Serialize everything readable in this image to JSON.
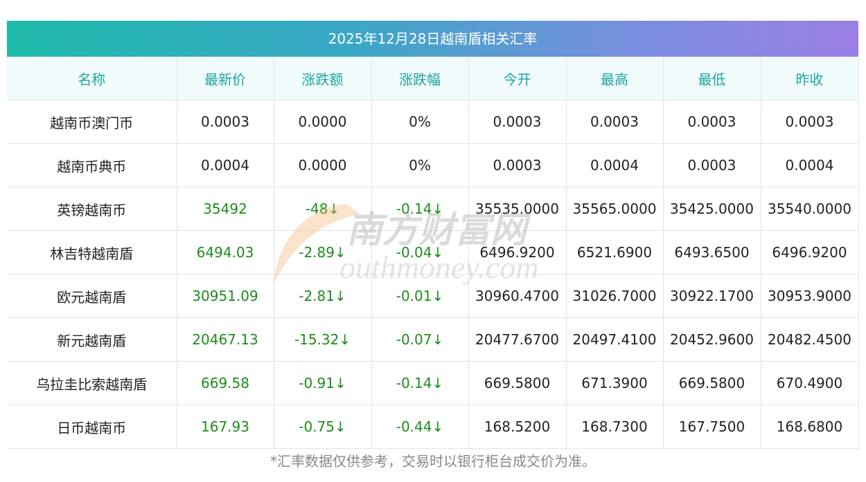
{
  "title": "2025年12月28日越南盾相关汇率",
  "headers": [
    "名称",
    "最新价",
    "涨跌额",
    "涨跌幅",
    "今开",
    "最高",
    "最低",
    "昨收"
  ],
  "rows": [
    [
      "越南币澳门币",
      "0.0003",
      "0.0000",
      "0%",
      "0.0003",
      "0.0003",
      "0.0003",
      "0.0003"
    ],
    [
      "越南币典币",
      "0.0004",
      "0.0000",
      "0%",
      "0.0003",
      "0.0004",
      "0.0003",
      "0.0004"
    ],
    [
      "英镑越南币",
      "35492",
      "-48↓",
      "-0.14↓",
      "35535.0000",
      "35565.0000",
      "35425.0000",
      "35540.0000"
    ],
    [
      "林吉特越南盾",
      "6494.03",
      "-2.89↓",
      "-0.04↓",
      "6496.9200",
      "6521.6900",
      "6493.6500",
      "6496.9200"
    ],
    [
      "欧元越南盾",
      "30951.09",
      "-2.81↓",
      "-0.01↓",
      "30960.4700",
      "31026.7000",
      "30922.1700",
      "30953.9000"
    ],
    [
      "新元越南盾",
      "20467.13",
      "-15.32↓",
      "-0.07↓",
      "20477.6700",
      "20497.4100",
      "20452.9600",
      "20482.4500"
    ],
    [
      "乌拉圭比索越南盾",
      "669.58",
      "-0.91↓",
      "-0.14↓",
      "669.5800",
      "671.3900",
      "669.5800",
      "670.4900"
    ],
    [
      "日币越南币",
      "167.93",
      "-0.75↓",
      "-0.44↓",
      "168.5200",
      "168.7300",
      "167.7500",
      "168.6800"
    ]
  ],
  "green_rows": [
    2,
    3,
    4,
    5,
    6,
    7
  ],
  "watermark": {
    "cn": "南方财富网",
    "en": "outhmoney.com"
  },
  "footnote": "*汇率数据仅供参考，交易时以银行柜台成交价为准。",
  "colors": {
    "header_text": "#1aa6a0",
    "down": "#1b8d1b",
    "gradient_start": "#1ebaa9",
    "gradient_end": "#9b7fe4"
  }
}
